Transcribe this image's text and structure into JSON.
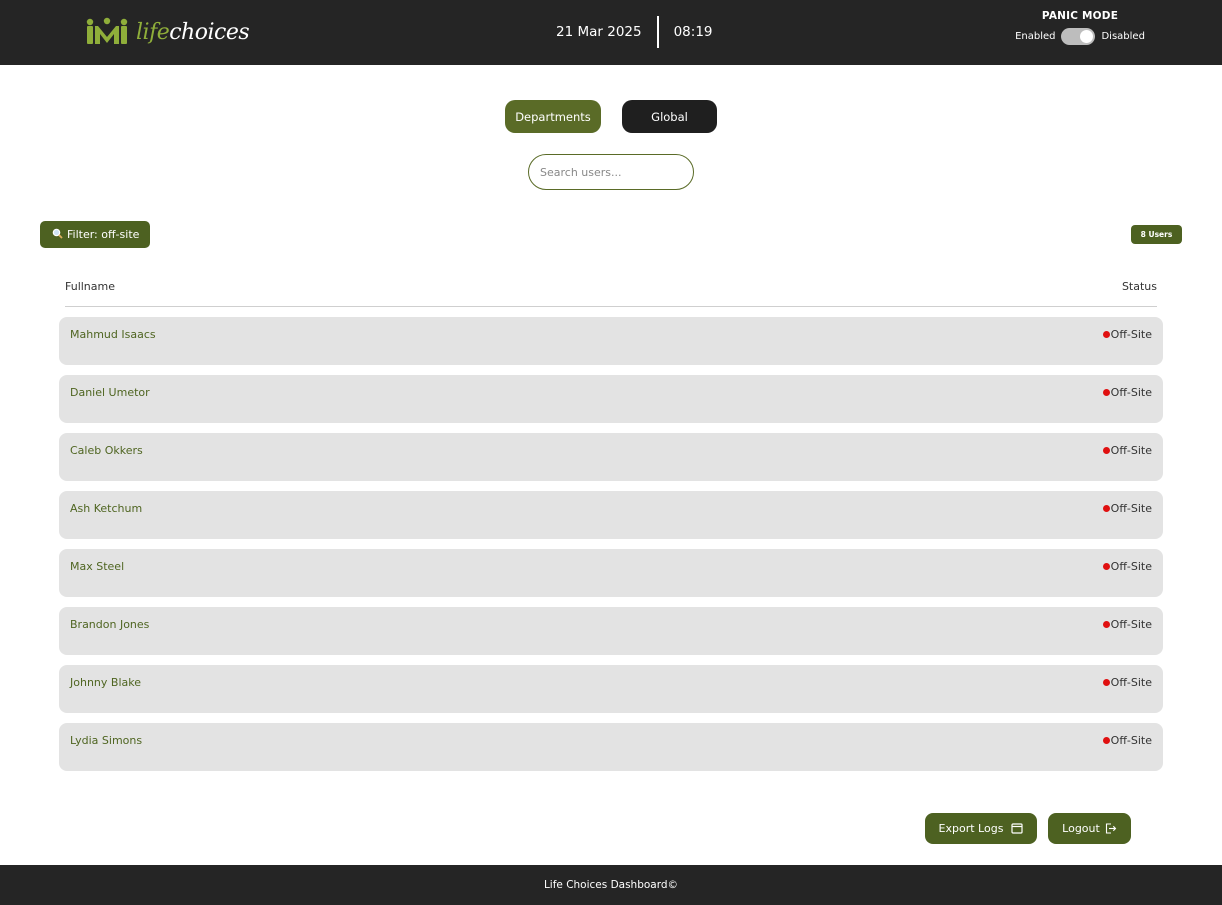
{
  "header": {
    "logo_life": "life",
    "logo_choices": "choices",
    "date": "21 Mar 2025",
    "time": "08:19",
    "panic": {
      "title": "PANIC MODE",
      "enabled_label": "Enabled",
      "disabled_label": "Disabled",
      "state": "Disabled"
    }
  },
  "tabs": [
    {
      "label": "Departments",
      "active": true
    },
    {
      "label": "Global",
      "active": false
    }
  ],
  "search": {
    "placeholder": "Search users...",
    "value": ""
  },
  "filter": {
    "label": "Filter: off-site",
    "icon": "magnifier-icon"
  },
  "user_count": "8 Users",
  "table": {
    "headers": {
      "name": "Fullname",
      "status": "Status"
    },
    "rows": [
      {
        "name": "Mahmud Isaacs",
        "status": "Off-Site"
      },
      {
        "name": "Daniel Umetor",
        "status": "Off-Site"
      },
      {
        "name": "Caleb Okkers",
        "status": "Off-Site"
      },
      {
        "name": "Ash Ketchum",
        "status": "Off-Site"
      },
      {
        "name": "Max Steel",
        "status": "Off-Site"
      },
      {
        "name": "Brandon Jones",
        "status": "Off-Site"
      },
      {
        "name": "Johnny Blake",
        "status": "Off-Site"
      },
      {
        "name": "Lydia Simons",
        "status": "Off-Site"
      }
    ]
  },
  "actions": {
    "export_label": "Export Logs",
    "export_icon": "calendar-icon",
    "logout_label": "Logout",
    "logout_icon": "logout-icon"
  },
  "footer": {
    "text": "Life Choices Dashboard©"
  },
  "colors": {
    "brand_green": "#4d6121",
    "header_bg": "#252525",
    "status_dot": "#e01010",
    "row_bg": "#e3e3e3"
  }
}
